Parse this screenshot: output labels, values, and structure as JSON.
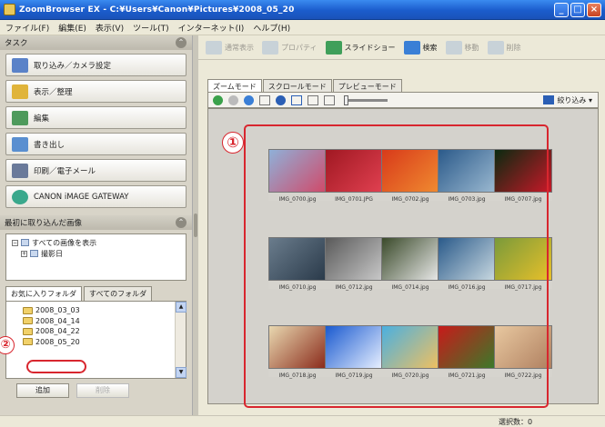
{
  "window": {
    "title": "ZoomBrowser EX  -  C:¥Users¥Canon¥Pictures¥2008_05_20",
    "btn_min": "_",
    "btn_max": "□",
    "btn_close": "×"
  },
  "menu": [
    "ファイル(F)",
    "編集(E)",
    "表示(V)",
    "ツール(T)",
    "インターネット(I)",
    "ヘルプ(H)"
  ],
  "tasks": {
    "header": "タスク",
    "items": [
      {
        "label": "取り込み／カメラ設定",
        "color": "#5a82c8"
      },
      {
        "label": "表示／整理",
        "color": "#e0b43a"
      },
      {
        "label": "編集",
        "color": "#4e9a5c"
      },
      {
        "label": "書き出し",
        "color": "#5a8fd0"
      },
      {
        "label": "印刷／電子メール",
        "color": "#6a7a9a"
      },
      {
        "label": "CANON iMAGE GATEWAY",
        "color": "#3aa88c"
      }
    ]
  },
  "recent": {
    "header": "最初に取り込んだ画像",
    "tree": [
      {
        "toggle": "−",
        "label": "すべての画像を表示"
      },
      {
        "toggle": "+",
        "label": "撮影日"
      }
    ]
  },
  "folders": {
    "tab_favorites": "お気に入りフォルダ",
    "tab_all": "すべてのフォルダ",
    "items": [
      "2008_03_03",
      "2008_04_14",
      "2008_04_22",
      "2008_05_20"
    ],
    "add_button": "追加",
    "delete_button": "削除"
  },
  "toolbar": {
    "items": [
      {
        "label": "通常表示",
        "enabled": false
      },
      {
        "label": "プロパティ",
        "enabled": false
      },
      {
        "label": "スライドショー",
        "enabled": true
      },
      {
        "label": "検索",
        "enabled": true
      },
      {
        "label": "移動",
        "enabled": false
      },
      {
        "label": "削除",
        "enabled": false
      }
    ]
  },
  "view_tabs": [
    "ズームモード",
    "スクロールモード",
    "プレビューモード"
  ],
  "view_toolbar": {
    "filter_label": "絞り込み ▾"
  },
  "annotations": {
    "one": "①",
    "two": "②",
    "accent": "#d8262e"
  },
  "thumbnails": [
    {
      "caption": "IMG_0700.jpg",
      "colors": [
        "#8fb0d8",
        "#d04a6a"
      ]
    },
    {
      "caption": "IMG_0701.JPG",
      "colors": [
        "#a01822",
        "#e04050"
      ]
    },
    {
      "caption": "IMG_0702.jpg",
      "colors": [
        "#d83a1a",
        "#f08a30"
      ]
    },
    {
      "caption": "IMG_0703.jpg",
      "colors": [
        "#2b5a8a",
        "#9ab8d0"
      ]
    },
    {
      "caption": "IMG_0707.jpg",
      "colors": [
        "#0a2a10",
        "#c81828"
      ]
    },
    {
      "caption": "IMG_0710.jpg",
      "colors": [
        "#6a7c8c",
        "#2a3a4a"
      ]
    },
    {
      "caption": "IMG_0712.jpg",
      "colors": [
        "#5a5a5a",
        "#c8c8c8"
      ]
    },
    {
      "caption": "IMG_0714.jpg",
      "colors": [
        "#3a4a2a",
        "#e8e8e8"
      ]
    },
    {
      "caption": "IMG_0716.jpg",
      "colors": [
        "#2a5a8a",
        "#c8d8e0"
      ]
    },
    {
      "caption": "IMG_0717.jpg",
      "colors": [
        "#7a9a3a",
        "#e8c02a"
      ]
    },
    {
      "caption": "IMG_0718.jpg",
      "colors": [
        "#e8d8b0",
        "#8a2a1a"
      ]
    },
    {
      "caption": "IMG_0719.jpg",
      "colors": [
        "#1a5ad0",
        "#e8f0ff"
      ]
    },
    {
      "caption": "IMG_0720.jpg",
      "colors": [
        "#4ab0e0",
        "#f0c060"
      ]
    },
    {
      "caption": "IMG_0721.jpg",
      "colors": [
        "#c81a1a",
        "#3a7a2a"
      ]
    },
    {
      "caption": "IMG_0722.jpg",
      "colors": [
        "#e8c8a0",
        "#b08060"
      ]
    }
  ],
  "status": "選択数：0"
}
